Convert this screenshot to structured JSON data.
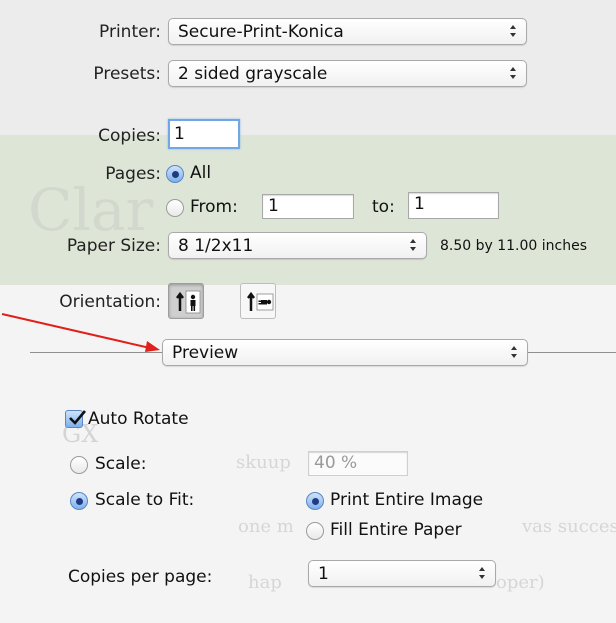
{
  "printer": {
    "label": "Printer:",
    "value": "Secure-Print-Konica"
  },
  "presets": {
    "label": "Presets:",
    "value": "2 sided grayscale"
  },
  "copies": {
    "label": "Copies:",
    "value": "1"
  },
  "pages": {
    "label": "Pages:",
    "all_label": "All",
    "from_label": "From:",
    "from_value": "1",
    "to_label": "to:",
    "to_value": "1",
    "selected": "All"
  },
  "paper_size": {
    "label": "Paper Size:",
    "value": "8 1/2x11",
    "dimensions": "8.50 by 11.00 inches"
  },
  "orientation": {
    "label": "Orientation:",
    "selected": "portrait"
  },
  "section_popup": {
    "value": "Preview"
  },
  "auto_rotate": {
    "label": "Auto Rotate",
    "checked": true
  },
  "scale": {
    "label": "Scale:",
    "value": "40 %"
  },
  "scale_to_fit": {
    "label": "Scale to Fit:",
    "selected": true,
    "print_entire_label": "Print Entire Image",
    "fill_entire_label": "Fill Entire Paper",
    "fit_option": "Print Entire Image"
  },
  "copies_per_page": {
    "label": "Copies per page:",
    "value": "1"
  },
  "annotation": {
    "arrow_color": "#e0201b"
  },
  "background_text": {
    "big": "Clar",
    "line1": "skuup",
    "line2": "one m",
    "line2b": "vas succes",
    "line3": "hap",
    "line3b": "oper)",
    "badge": "GX"
  },
  "colors": {
    "accent": "#5b86c2",
    "focus": "#72a7e6"
  }
}
